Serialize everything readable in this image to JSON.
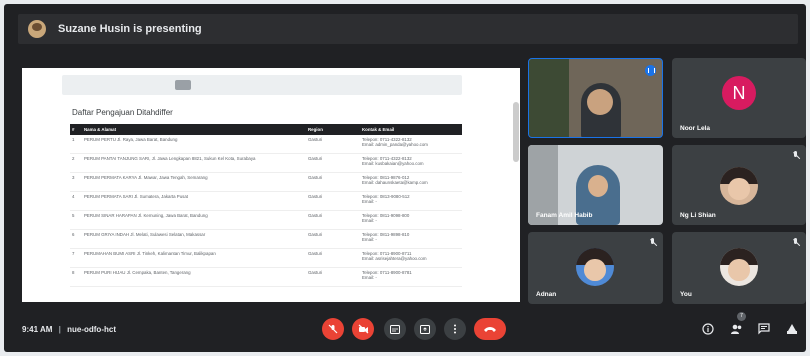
{
  "topbar": {
    "presenting_text": "Suzane Husin is presenting"
  },
  "shared_screen": {
    "doc_title": "Daftar Pengajuan Ditahdiffer",
    "table": {
      "headers": [
        "#",
        "Nama & Alamat",
        "Region",
        "Kontak & Email"
      ],
      "rows": [
        [
          "1",
          "PERUM PERTU Jl. Raya, Jawa Barat, Bandung",
          "Gasturi",
          "Telepon: 0711-4322-8132\nEmail: admin_panda@yahoo.com"
        ],
        [
          "2",
          "PERUM PANTAI TANJUNG SARI, Jl. Jawa Lengkapan 8821, Sukun Kel Kota, Surabaya",
          "Gasturi",
          "Telepon: 0711-4322-8132\nEmail: kusbakaian@yahoo.com"
        ],
        [
          "3",
          "PERUM PERMATA KARYA Jl. Mawar, Jawa Tengah, Semarang",
          "Gasturi",
          "Telepon: 0811-9876-012\nEmail: dahaunskaeta@kamp.com"
        ],
        [
          "4",
          "PERUM PERMATA SARI Jl. Sumatera, Jakarta Pusat",
          "Gasturi",
          "Telepon: 0813-9080-512\nEmail: -"
        ],
        [
          "5",
          "PERUM SINAR HARAPAN Jl. Kemuning, Jawa Barat, Bandung",
          "Gasturi",
          "Telepon: 0811-9098-800\nEmail: -"
        ],
        [
          "6",
          "PERUM GRIYA INDAH Jl. Melati, Sulawesi Selatan, Makassar",
          "Gasturi",
          "Telepon: 0811-9898-810\nEmail: -"
        ],
        [
          "7",
          "PERUMAHAN BUMI ASRI Jl. Tinkeh, Kalimantan Timur, Balikpapan",
          "Gasturi",
          "Telepon: 0711-8900-8711\nEmail: asrisejahtera@yahoo.com"
        ],
        [
          "8",
          "PERUM PURI HIJAU Jl. Cempaka, Banten, Tangerang",
          "Gasturi",
          "Telepon: 0711-8900-8781\nEmail: -"
        ]
      ]
    }
  },
  "participants": [
    {
      "name": "",
      "state": "speaking"
    },
    {
      "name": "Noor Lela",
      "initial": "N",
      "avatar_color": "#d81b60",
      "state": "muted"
    },
    {
      "name": "Fanam Amil Habib",
      "state": "video"
    },
    {
      "name": "Ng Li Shian",
      "state": "muted"
    },
    {
      "name": "Adnan",
      "state": "muted"
    },
    {
      "name": "You",
      "state": "muted"
    }
  ],
  "bottombar": {
    "time": "9:41 AM",
    "separator": "|",
    "meeting_code": "nue-odfo-hct",
    "participant_count": "7"
  },
  "colors": {
    "accent": "#1a73e8",
    "danger": "#ea4335",
    "background": "#202124",
    "tile": "#3c4043"
  }
}
